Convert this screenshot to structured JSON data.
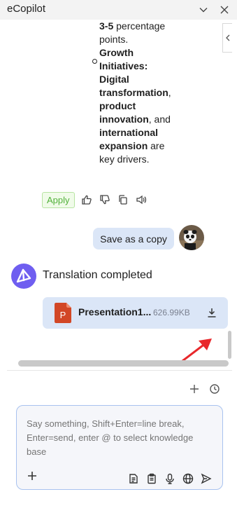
{
  "app": {
    "title": "eCopilot"
  },
  "window_controls": {
    "collapse_icon": "chevron-down-icon",
    "close_icon": "close-icon"
  },
  "message_list": {
    "lines": [
      {
        "bold": "3-5",
        "rest": " percentage"
      },
      {
        "bold": "",
        "rest": "points."
      },
      {
        "bold": "Growth",
        "rest": ""
      },
      {
        "bold": "Initiatives:",
        "rest": ""
      },
      {
        "bold": "Digital",
        "rest": ""
      },
      {
        "bold": "transformation",
        "rest": ","
      },
      {
        "bold": "product",
        "rest": ""
      },
      {
        "bold": "innovation",
        "rest": ", and"
      },
      {
        "bold": "international",
        "rest": ""
      },
      {
        "bold": "expansion",
        "rest": " are"
      },
      {
        "bold": "",
        "rest": "key drivers."
      }
    ]
  },
  "message_actions": {
    "apply_label": "Apply",
    "icons": [
      "thumbs-up-icon",
      "thumbs-down-icon",
      "copy-icon",
      "speaker-icon"
    ]
  },
  "user_message": {
    "text": "Save as a copy"
  },
  "bot_message": {
    "text": "Translation completed"
  },
  "file_card": {
    "name": "Presentation1...",
    "size": "626.99KB",
    "icon": "ppt-file-icon",
    "action_icon": "download-icon"
  },
  "toolbar": {
    "new_icon": "plus-icon",
    "history_icon": "history-icon"
  },
  "input": {
    "placeholder": "Say something, Shift+Enter=line break, Enter=send, enter @ to select knowledge base",
    "tool_icons": [
      "document-list-icon",
      "clipboard-icon",
      "microphone-icon",
      "globe-icon",
      "send-icon"
    ]
  },
  "colors": {
    "accent": "#6f5ef0",
    "bubble": "#dbe6f7",
    "apply_green": "#52b13b",
    "ppt_red": "#d24726",
    "annotation_red": "#e8272b"
  }
}
